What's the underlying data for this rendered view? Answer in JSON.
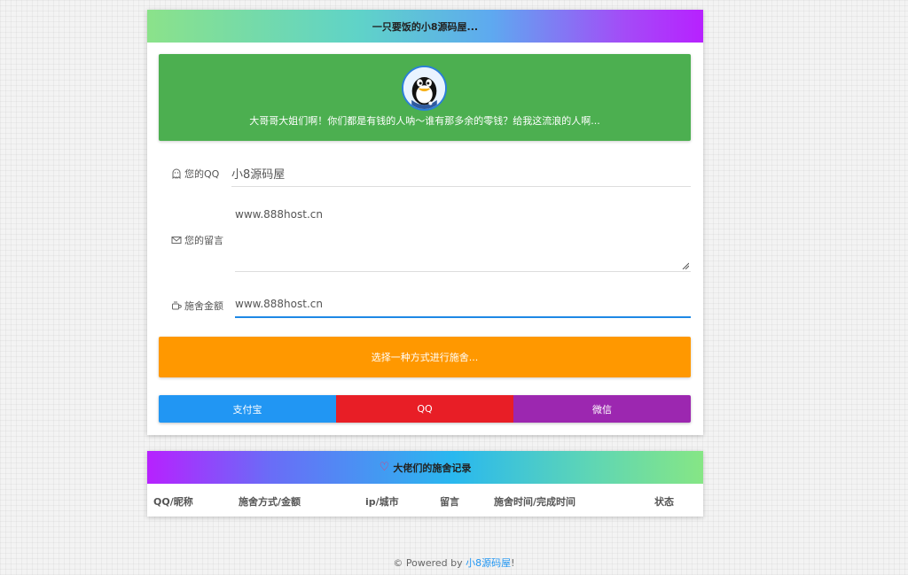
{
  "header": {
    "title": "一只要饭的小8源码屋..."
  },
  "banner": {
    "text": "大哥哥大姐们啊！你们都是有钱的人呐～谁有那多余的零钱？给我这流浪的人啊..."
  },
  "form": {
    "qq": {
      "label": "您的QQ",
      "value": "小8源码屋",
      "icon": "ghost-icon"
    },
    "message": {
      "label": "您的留言",
      "value": "www.888host.cn",
      "icon": "envelope-icon"
    },
    "amount": {
      "label": "施舍金额",
      "value": "www.888host.cn",
      "icon": "cup-icon"
    }
  },
  "choose_button": "选择一种方式进行施舍...",
  "payments": {
    "alipay": "支付宝",
    "qq": "QQ",
    "wechat": "微信"
  },
  "records": {
    "title": "大佬们的施舍记录",
    "columns": [
      "QQ/昵称",
      "施舍方式/金额",
      "ip/城市",
      "留言",
      "施舍时间/完成时间",
      "状态"
    ]
  },
  "footer": {
    "prefix": "© Powered by ",
    "link": "小8源码屋",
    "suffix": "!"
  },
  "colors": {
    "banner": "#4caf50",
    "choose_button": "#ff9800",
    "alipay": "#2196f3",
    "qq": "#e81e26",
    "wechat": "#9c27b0",
    "focus_underline": "#1e88e5"
  }
}
